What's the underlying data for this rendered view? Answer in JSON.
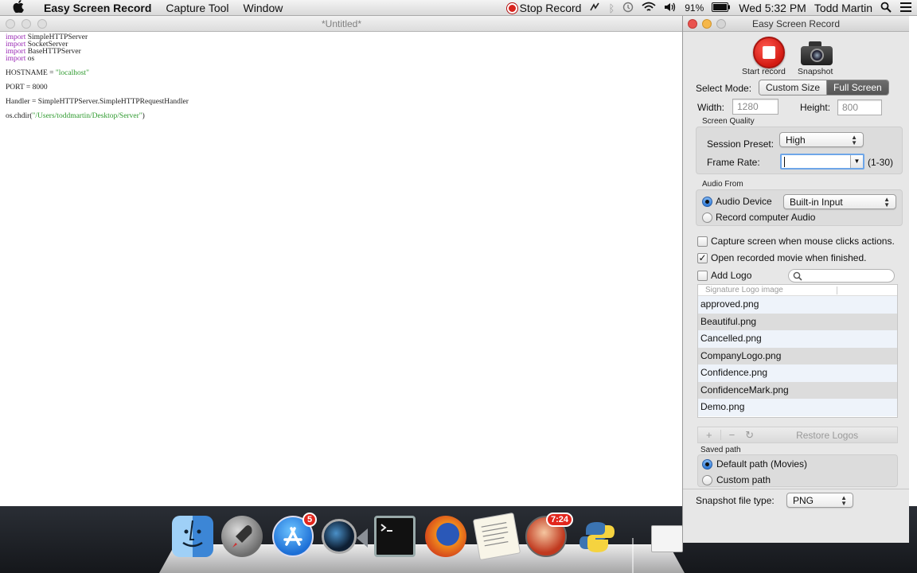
{
  "menubar": {
    "app_name": "Easy Screen Record",
    "menus": [
      "Capture Tool",
      "Window"
    ],
    "stop_record": "Stop Record",
    "battery": "91%",
    "clock": "Wed 5:32 PM",
    "user": "Todd Martin"
  },
  "editor": {
    "title": "*Untitled*",
    "lines": [
      [
        {
          "t": "import",
          "k": "kw"
        },
        {
          "t": " SimpleHTTPServer",
          "k": ""
        }
      ],
      [
        {
          "t": "import",
          "k": "kw"
        },
        {
          "t": " SocketServer",
          "k": ""
        }
      ],
      [
        {
          "t": "import",
          "k": "kw"
        },
        {
          "t": " BaseHTTPServer",
          "k": ""
        }
      ],
      [
        {
          "t": "import",
          "k": "kw"
        },
        {
          "t": " os",
          "k": ""
        }
      ],
      [],
      [
        {
          "t": "HOSTNAME = ",
          "k": ""
        },
        {
          "t": "\"localhost\"",
          "k": "str"
        }
      ],
      [],
      [
        {
          "t": "PORT = 8000",
          "k": ""
        }
      ],
      [],
      [
        {
          "t": "Handler = SimpleHTTPServer.SimpleHTTPRequestHandler",
          "k": ""
        }
      ],
      [],
      [
        {
          "t": "os.chdir(",
          "k": ""
        },
        {
          "t": "\"/Users/toddmartin/Desktop/Server\"",
          "k": "str"
        },
        {
          "t": ")",
          "k": ""
        }
      ]
    ]
  },
  "panel": {
    "title": "Easy Screen Record",
    "start_record": "Start record",
    "snapshot": "Snapshot",
    "select_mode_label": "Select Mode:",
    "mode_custom": "Custom Size",
    "mode_full": "Full Screen",
    "width_label": "Width:",
    "width_value": "1280",
    "height_label": "Height:",
    "height_value": "800",
    "screen_quality": "Screen  Quality",
    "session_preset_label": "Session Preset:",
    "session_preset_value": "High",
    "frame_rate_label": "Frame Rate:",
    "frame_rate_value": "",
    "frame_rate_range": "(1-30)",
    "audio_from": "Audio From",
    "audio_device": "Audio Device",
    "audio_device_value": "Built-in Input",
    "record_computer_audio": "Record computer Audio",
    "capture_mouse": "Capture screen when mouse clicks actions.",
    "open_movie": "Open recorded movie when finished.",
    "add_logo": "Add Logo",
    "list_header": "Signature Logo image",
    "logos": [
      "approved.png",
      "Beautiful.png",
      "Cancelled.png",
      "CompanyLogo.png",
      "Confidence.png",
      "ConfidenceMark.png",
      "Demo.png"
    ],
    "add_btn": "+",
    "remove_btn": "−",
    "refresh_btn": "↻",
    "restore_logos": "Restore Logos",
    "saved_path": "Saved path",
    "default_path": "Default path (Movies)",
    "custom_path": "Custom path",
    "snapshot_type_label": "Snapshot file type:",
    "snapshot_type_value": "PNG"
  },
  "dock": {
    "appstore_badge": "5",
    "clock_badge": "7:24"
  },
  "colors": {
    "record_red": "#d31a12",
    "selected_segment": "#5f5f5f"
  }
}
